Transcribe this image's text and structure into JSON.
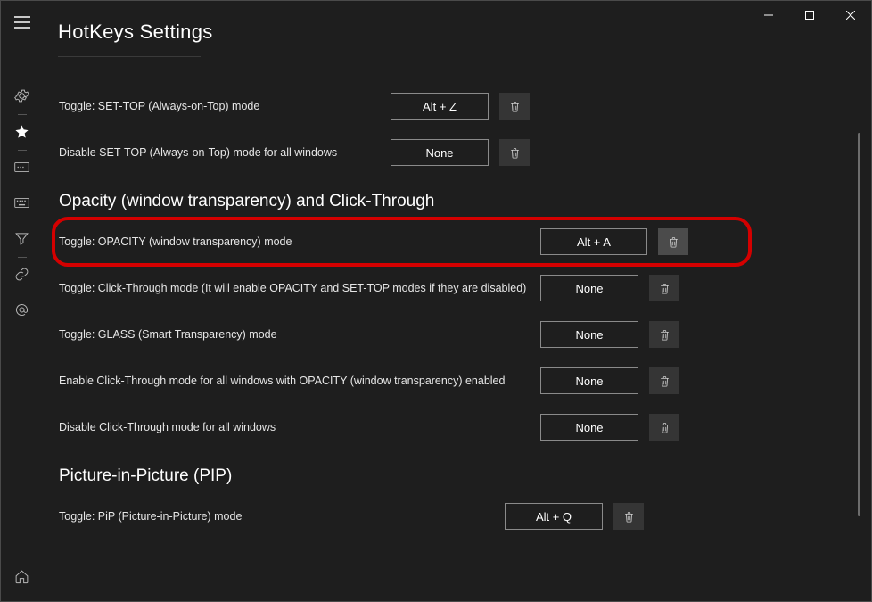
{
  "window": {
    "title": "HotKeys Settings"
  },
  "sidebar": {
    "items": [
      {
        "name": "gear-icon"
      },
      {
        "name": "star-icon"
      },
      {
        "name": "card-icon"
      },
      {
        "name": "keyboard-icon"
      },
      {
        "name": "filter-icon"
      },
      {
        "name": "link-icon"
      },
      {
        "name": "at-icon"
      }
    ],
    "home": {
      "name": "home-icon"
    }
  },
  "sections": [
    {
      "id": "settop",
      "rows": [
        {
          "label": "Toggle: SET-TOP (Always-on-Top) mode",
          "hotkey": "Alt + Z"
        },
        {
          "label": "Disable SET-TOP (Always-on-Top) mode for all windows",
          "hotkey": "None"
        }
      ]
    },
    {
      "id": "opacity",
      "title": "Opacity (window transparency) and Click-Through",
      "rows": [
        {
          "label": "Toggle: OPACITY (window transparency) mode",
          "hotkey": "Alt + A",
          "highlighted": true
        },
        {
          "label": "Toggle: Click-Through mode (It will enable OPACITY and SET-TOP modes if they are disabled)",
          "hotkey": "None"
        },
        {
          "label": "Toggle: GLASS (Smart Transparency) mode",
          "hotkey": "None"
        },
        {
          "label": "Enable Click-Through mode for all windows with OPACITY (window transparency) enabled",
          "hotkey": "None"
        },
        {
          "label": "Disable Click-Through mode for all windows",
          "hotkey": "None"
        }
      ]
    },
    {
      "id": "pip",
      "title": "Picture-in-Picture (PIP)",
      "rows": [
        {
          "label": "Toggle: PiP (Picture-in-Picture) mode",
          "hotkey": "Alt + Q"
        }
      ]
    }
  ]
}
